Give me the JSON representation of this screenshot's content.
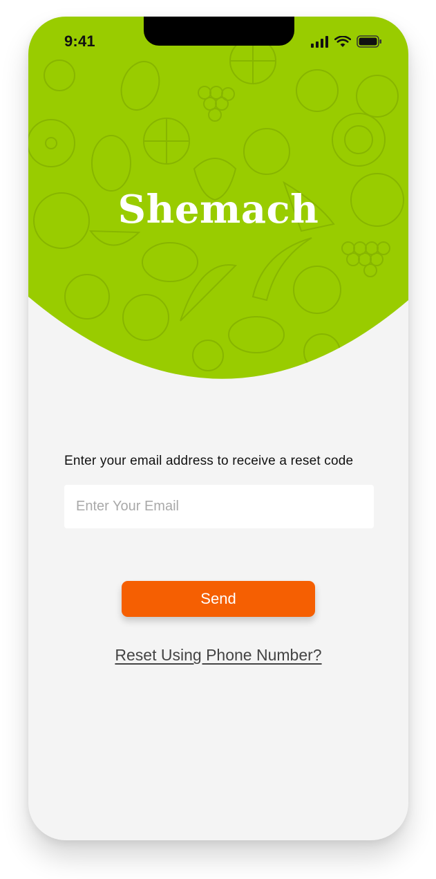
{
  "status_bar": {
    "time": "9:41"
  },
  "icons": {
    "signal": "cellular-signal-icon",
    "wifi": "wifi-icon",
    "battery": "battery-icon"
  },
  "header": {
    "brand": "Shemach"
  },
  "form": {
    "instructions": "Enter your email address to receive a reset code",
    "email_placeholder": "Enter Your Email",
    "email_value": "",
    "send_label": "Send",
    "alt_reset_label": "Reset Using Phone Number?"
  },
  "colors": {
    "hero_green": "#99cc00",
    "accent_orange": "#f55f02",
    "background": "#f4f4f4"
  }
}
